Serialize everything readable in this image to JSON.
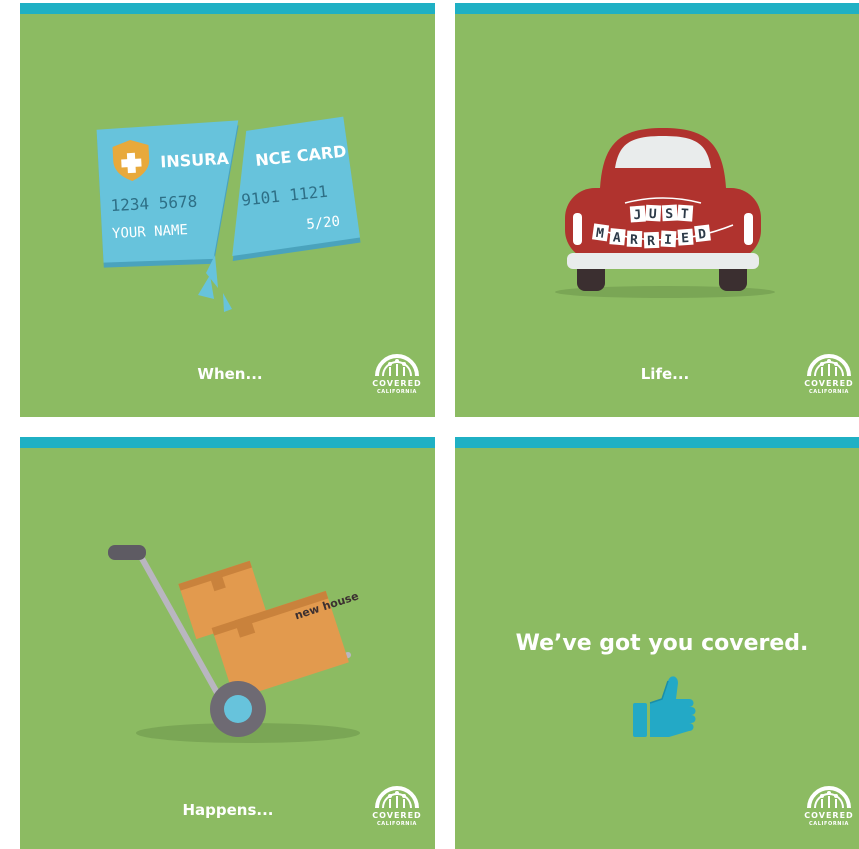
{
  "colors": {
    "panel_green": "#8cbb62",
    "top_bar_teal": "#1fb0c4",
    "card_blue": "#67c3dc",
    "car_red": "#b0332e",
    "box_orange": "#e29a4e",
    "thumb_blue": "#23a9c6",
    "text_white": "#ffffff"
  },
  "panels": [
    {
      "caption": "When...",
      "card": {
        "title_left": "INSURA",
        "title_right": "NCE CARD",
        "number_left": "1234 5678",
        "number_right": "9101 1121",
        "name": "YOUR NAME",
        "expiry": "5/20"
      },
      "icons": [
        "broken-insurance-card-icon",
        "shield-cross-icon"
      ]
    },
    {
      "caption": "Life...",
      "sign_line1": [
        "J",
        "U",
        "S",
        "T"
      ],
      "sign_line2": [
        "M",
        "A",
        "R",
        "R",
        "I",
        "E",
        "D"
      ],
      "icons": [
        "wedding-car-icon"
      ]
    },
    {
      "caption": "Happens...",
      "box_label": "new house",
      "icons": [
        "hand-truck-icon",
        "moving-box-icon"
      ]
    },
    {
      "tagline": "We’ve got you covered.",
      "icons": [
        "thumbs-up-icon"
      ]
    }
  ],
  "logo": {
    "line1": "COVERED",
    "line2": "CALIFORNIA"
  }
}
